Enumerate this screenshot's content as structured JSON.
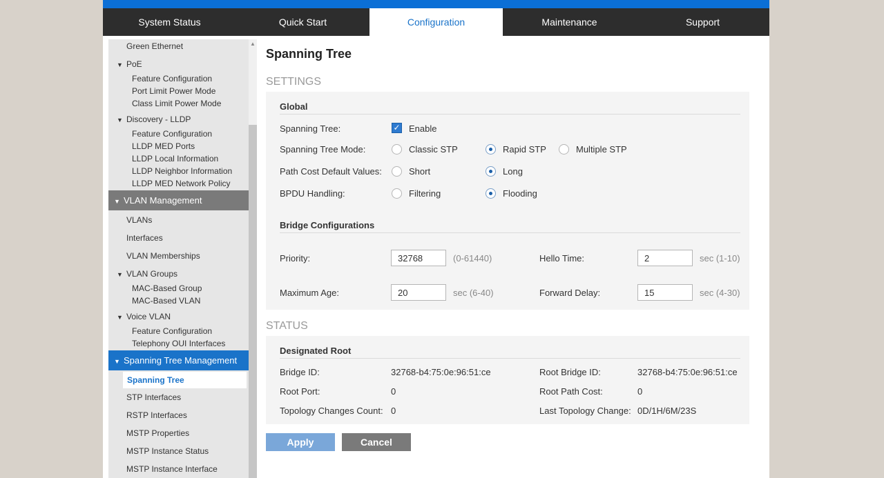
{
  "nav": {
    "tabs": [
      {
        "label": "System Status"
      },
      {
        "label": "Quick Start"
      },
      {
        "label": "Configuration"
      },
      {
        "label": "Maintenance"
      },
      {
        "label": "Support"
      }
    ],
    "active": "Configuration"
  },
  "sidebar": {
    "green_ethernet": "Green Ethernet",
    "poe": "PoE",
    "poe_feature_config": "Feature Configuration",
    "port_limit_power_mode": "Port Limit Power Mode",
    "class_limit_power_mode": "Class Limit Power Mode",
    "discovery_lldp": "Discovery - LLDP",
    "lldp_feature_config": "Feature Configuration",
    "lldp_med_ports": "LLDP MED Ports",
    "lldp_local_info": "LLDP Local Information",
    "lldp_neighbor_info": "LLDP Neighbor Information",
    "lldp_med_network_policy": "LLDP MED Network Policy",
    "vlan_management": "VLAN Management",
    "vlans": "VLANs",
    "interfaces": "Interfaces",
    "vlan_memberships": "VLAN Memberships",
    "vlan_groups": "VLAN Groups",
    "mac_based_group": "MAC-Based Group",
    "mac_based_vlan": "MAC-Based VLAN",
    "voice_vlan": "Voice VLAN",
    "voice_feature_config": "Feature Configuration",
    "telephony_oui": "Telephony OUI Interfaces",
    "spanning_tree_management": "Spanning Tree Management",
    "spanning_tree": "Spanning Tree",
    "stp_interfaces": "STP Interfaces",
    "rstp_interfaces": "RSTP Interfaces",
    "mstp_properties": "MSTP Properties",
    "mstp_instance_status": "MSTP Instance Status",
    "mstp_instance_interface": "MSTP Instance Interface"
  },
  "page": {
    "title": "Spanning Tree",
    "settings_label": "SETTINGS",
    "status_label": "STATUS"
  },
  "global": {
    "title": "Global",
    "spanning_tree_label": "Spanning Tree:",
    "enable_label": "Enable",
    "enable_checked": true,
    "mode_label": "Spanning Tree Mode:",
    "mode_options": [
      "Classic STP",
      "Rapid STP",
      "Multiple STP"
    ],
    "mode_selected": "Rapid STP",
    "path_cost_label": "Path Cost Default Values:",
    "path_cost_options": [
      "Short",
      "Long"
    ],
    "path_cost_selected": "Long",
    "bpdu_label": "BPDU Handling:",
    "bpdu_options": [
      "Filtering",
      "Flooding"
    ],
    "bpdu_selected": "Flooding"
  },
  "bridge": {
    "title": "Bridge Configurations",
    "priority_label": "Priority:",
    "priority_value": "32768",
    "priority_hint": "(0-61440)",
    "hello_label": "Hello Time:",
    "hello_value": "2",
    "hello_hint": "sec (1-10)",
    "max_age_label": "Maximum Age:",
    "max_age_value": "20",
    "max_age_hint": "sec (6-40)",
    "forward_label": "Forward Delay:",
    "forward_value": "15",
    "forward_hint": "sec (4-30)"
  },
  "status": {
    "title": "Designated Root",
    "bridge_id_label": "Bridge ID:",
    "bridge_id": "32768-b4:75:0e:96:51:ce",
    "root_bridge_id_label": "Root Bridge ID:",
    "root_bridge_id": "32768-b4:75:0e:96:51:ce",
    "root_port_label": "Root Port:",
    "root_port": "0",
    "root_path_cost_label": "Root Path Cost:",
    "root_path_cost": "0",
    "topology_changes_label": "Topology Changes Count:",
    "topology_changes": "0",
    "last_topology_label": "Last Topology Change:",
    "last_topology": "0D/1H/6M/23S"
  },
  "actions": {
    "apply": "Apply",
    "cancel": "Cancel"
  },
  "colors": {
    "accent": "#1a73c9",
    "topbar": "#0b6fd6",
    "nav_bg": "#2d2d2d"
  }
}
